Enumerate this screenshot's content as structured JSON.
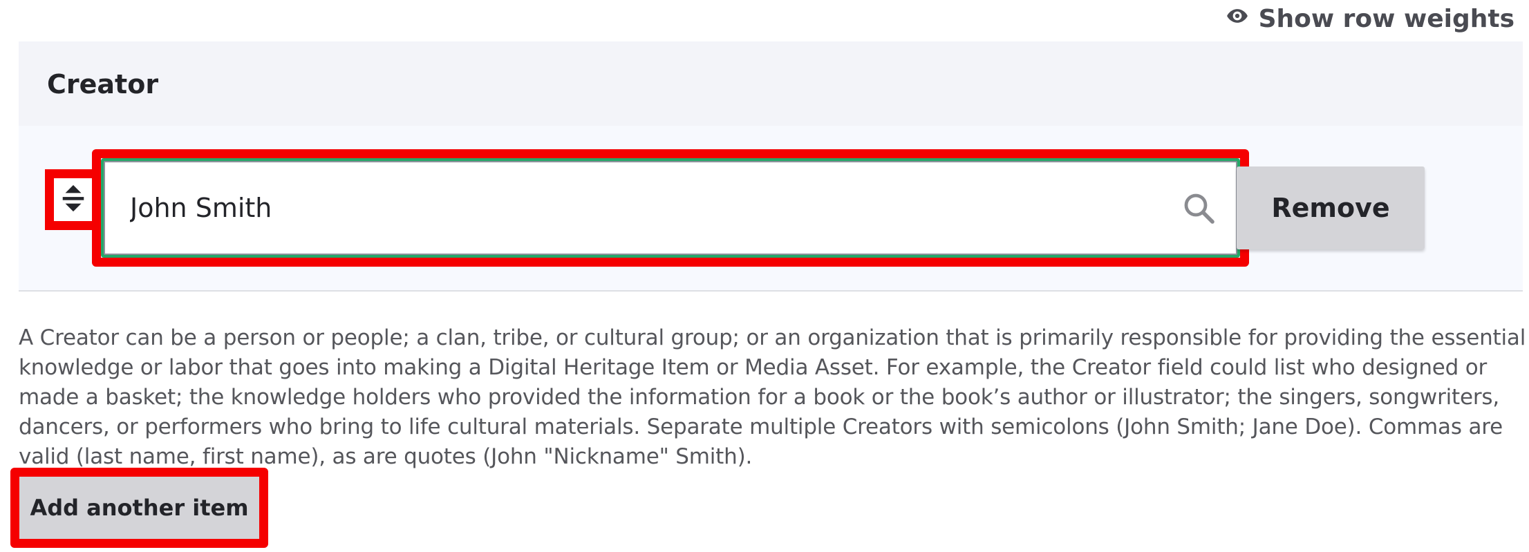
{
  "header_actions": {
    "show_row_weights_label": "Show row weights",
    "show_row_weights_icon": "eye-icon"
  },
  "creator_field": {
    "title": "Creator",
    "rows": [
      {
        "drag_handle_icon": "drag-handle-icon",
        "value": "John Smith",
        "search_icon": "search-icon",
        "remove_label": "Remove"
      }
    ],
    "description": "A Creator can be a person or people; a clan, tribe, or cultural group; or an organization that is primarily responsible for providing the essential knowledge or labor that goes into making a Digital Heritage Item or Media Asset. For example, the Creator field could list who designed or made a basket; the knowledge holders who provided the information for a book or the book’s author or illustrator; the singers, songwriters, dancers, or performers who bring to life cultural materials. Separate multiple Creators with semicolons (John Smith; Jane Doe). Commas are valid (last name, first name), as are quotes (John \"Nickname\" Smith).",
    "add_another_label": "Add another item"
  },
  "colors": {
    "highlight": "#f50000",
    "focus_ring": "#26a769",
    "button_bg": "#d4d4d8",
    "header_bg": "#f3f4f9",
    "row_bg": "#f7f9fe"
  }
}
